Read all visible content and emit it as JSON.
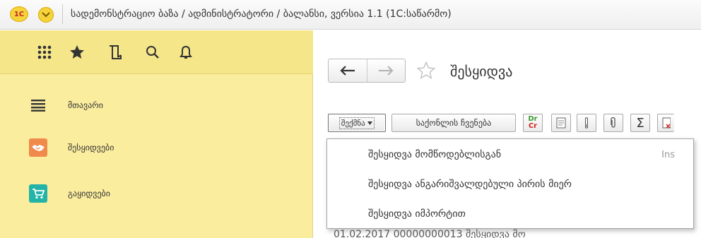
{
  "app": {
    "logo_text": "1C",
    "window_title": "სადემონსტრაციო ბაზა / ადმინისტრატორი / ბალანსი, ვერსია 1.1  (1C:საწარმო)"
  },
  "sidebar": {
    "top_icons": [
      {
        "name": "apps-grid-icon"
      },
      {
        "name": "favorites-star-icon"
      },
      {
        "name": "history-icon"
      },
      {
        "name": "search-icon"
      },
      {
        "name": "notifications-bell-icon"
      }
    ],
    "items": [
      {
        "label": "მთავარი",
        "icon": "menu-lines-icon"
      },
      {
        "label": "შესყიდვები",
        "icon": "handshake-icon",
        "color": "#f08a4b"
      },
      {
        "label": "გაყიდვები",
        "icon": "cart-icon",
        "color": "#23b3a8"
      }
    ]
  },
  "main": {
    "page_title": "შესყიდვა",
    "toolbar": {
      "create_label": "შექმნა",
      "show_goods_label": "საქონლის ჩვენება",
      "dr_cr_top": "Dr",
      "dr_cr_bottom": "Cr",
      "sum_symbol": "Σ"
    },
    "dropdown": {
      "items": [
        {
          "label": "შესყიდვა მომწოდებლისგან",
          "shortcut": "Ins"
        },
        {
          "label": "შესყიდვა ანგარიშვალდებული პირის მიერ",
          "shortcut": ""
        },
        {
          "label": "შესყიდვა იმპორტით",
          "shortcut": ""
        }
      ]
    },
    "list_fragment": "01.02.2017      00000000013     შესყიდვა მო"
  },
  "colors": {
    "sidebar_bg": "#fbed9e",
    "accent_orange": "#f08a4b",
    "accent_teal": "#23b3a8",
    "dr_green": "#3b9a2e",
    "cr_red": "#d0261f"
  }
}
